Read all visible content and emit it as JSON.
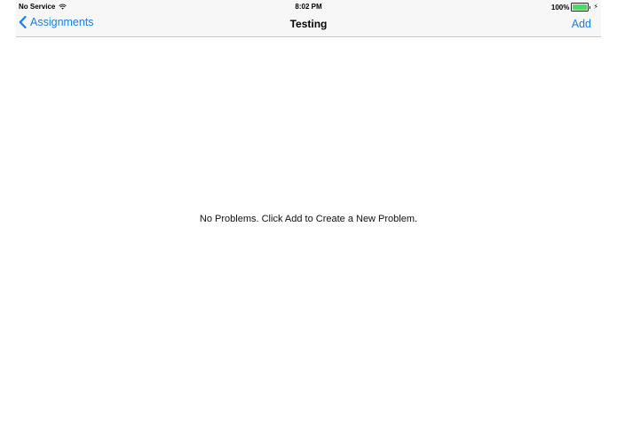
{
  "status_bar": {
    "carrier": "No Service",
    "time": "8:02 PM",
    "battery_percent": "100%",
    "battery_level": 1.0,
    "battery_color": "#4cd964"
  },
  "nav_bar": {
    "back_label": "Assignments",
    "title": "Testing",
    "add_label": "Add",
    "accent_color": "#1a7ee8"
  },
  "main": {
    "empty_message": "No Problems. Click Add to Create a New Problem."
  },
  "icons": {
    "wifi": "wifi-icon",
    "back": "chevron-left-icon",
    "battery": "battery-icon",
    "charging": "lightning-bolt-icon"
  }
}
